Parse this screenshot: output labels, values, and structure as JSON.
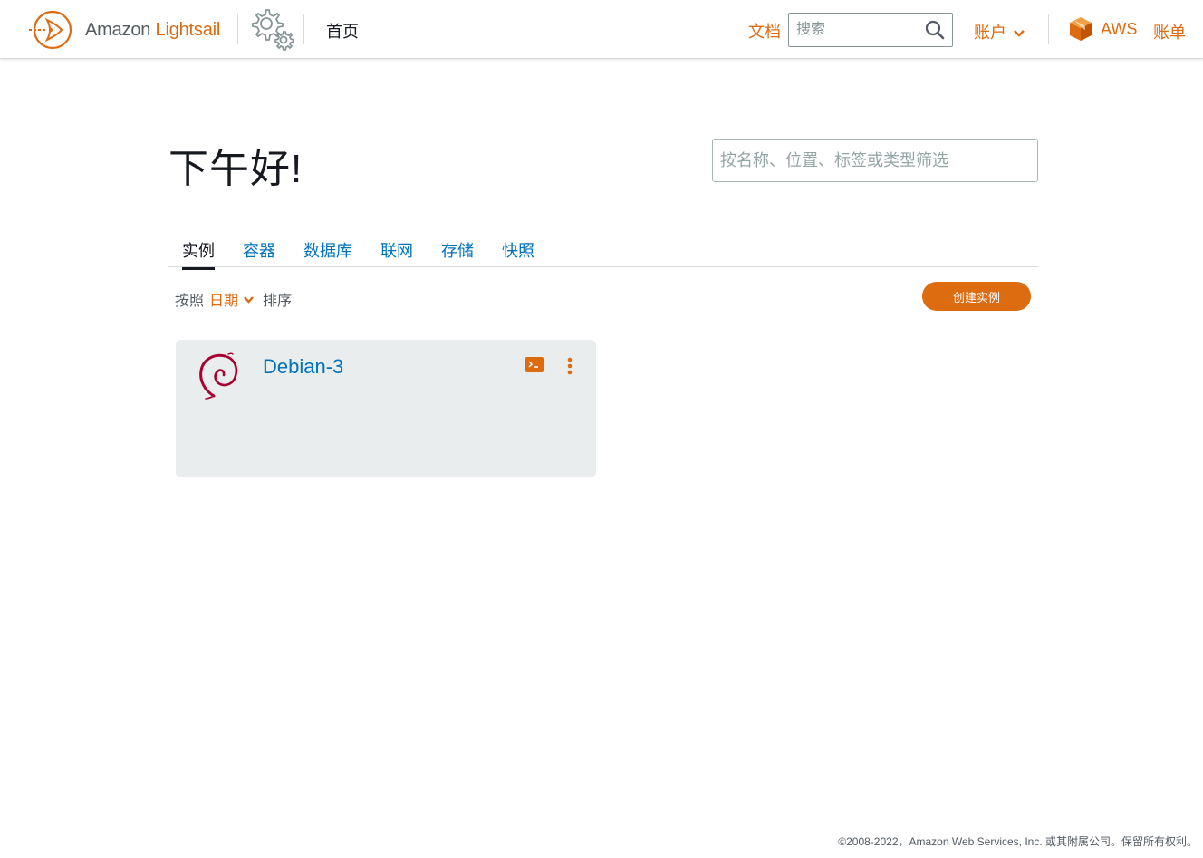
{
  "header": {
    "brand_prefix": "Amazon",
    "brand_name": "Lightsail",
    "home_label": "首页",
    "docs_label": "文档",
    "search_placeholder": "搜索",
    "account_label": "账户",
    "aws_label": "AWS",
    "billing_label": "账单"
  },
  "main": {
    "greeting": "下午好!",
    "filter_placeholder": "按名称、位置、标签或类型筛选",
    "tabs": [
      {
        "label": "实例",
        "active": true
      },
      {
        "label": "容器",
        "active": false
      },
      {
        "label": "数据库",
        "active": false
      },
      {
        "label": "联网",
        "active": false
      },
      {
        "label": "存储",
        "active": false
      },
      {
        "label": "快照",
        "active": false
      }
    ],
    "sort": {
      "prefix": "按照",
      "key": "日期",
      "suffix": "排序"
    },
    "create_button_label": "创建实例",
    "instances": [
      {
        "name": "Debian-3",
        "os_icon": "debian-icon"
      }
    ]
  },
  "footer": {
    "copyright": "©2008-2022，Amazon Web Services, Inc. 或其附属公司。保留所有权利。"
  },
  "colors": {
    "brand_orange": "#dd6b10",
    "link_blue": "#0073bb",
    "card_bg": "#eaeded",
    "debian_red": "#a80030"
  }
}
